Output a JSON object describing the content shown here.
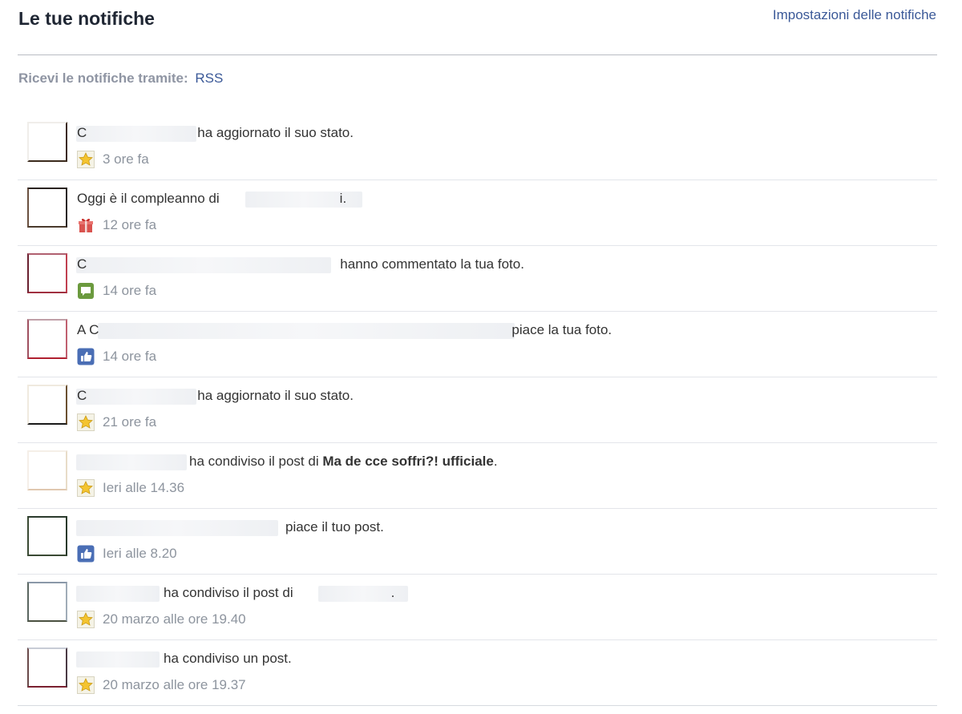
{
  "header": {
    "title": "Le tue notifiche",
    "settings_link": "Impostazioni delle notifiche"
  },
  "rss": {
    "label": "Ricevi le notifiche tramite:",
    "link": "RSS"
  },
  "notifications": [
    {
      "name_partial": "C",
      "action": "ha aggiornato il suo stato.",
      "icon": "star-icon",
      "time": "3 ore fa"
    },
    {
      "prefix": "Oggi è il compleanno di",
      "suffix": "i.",
      "icon": "gift-icon",
      "time": "12 ore fa"
    },
    {
      "name_partial": "C",
      "action": "hanno commentato la tua foto.",
      "icon": "comment-icon",
      "time": "14 ore fa"
    },
    {
      "name_partial": "A C",
      "action": "piace la tua foto.",
      "icon": "like-icon",
      "time": "14 ore fa"
    },
    {
      "name_partial": "C",
      "action": "ha aggiornato il suo stato.",
      "icon": "star-icon",
      "time": "21 ore fa"
    },
    {
      "action": "ha condiviso il post di",
      "object": "Ma de cce soffri?! ufficiale",
      "suffix": ".",
      "icon": "star-icon",
      "time": "Ieri alle 14.36"
    },
    {
      "action": "piace il tuo post.",
      "icon": "like-icon",
      "time": "Ieri alle 8.20"
    },
    {
      "action": "ha condiviso il post di",
      "suffix": ".",
      "icon": "star-icon",
      "time": "20 marzo alle ore 19.40"
    },
    {
      "action": "ha condiviso un post.",
      "icon": "star-icon",
      "time": "20 marzo alle ore 19.37"
    }
  ],
  "colors": {
    "link": "#3b5998",
    "meta": "#8d949e",
    "divider": "#b9bcc3"
  }
}
